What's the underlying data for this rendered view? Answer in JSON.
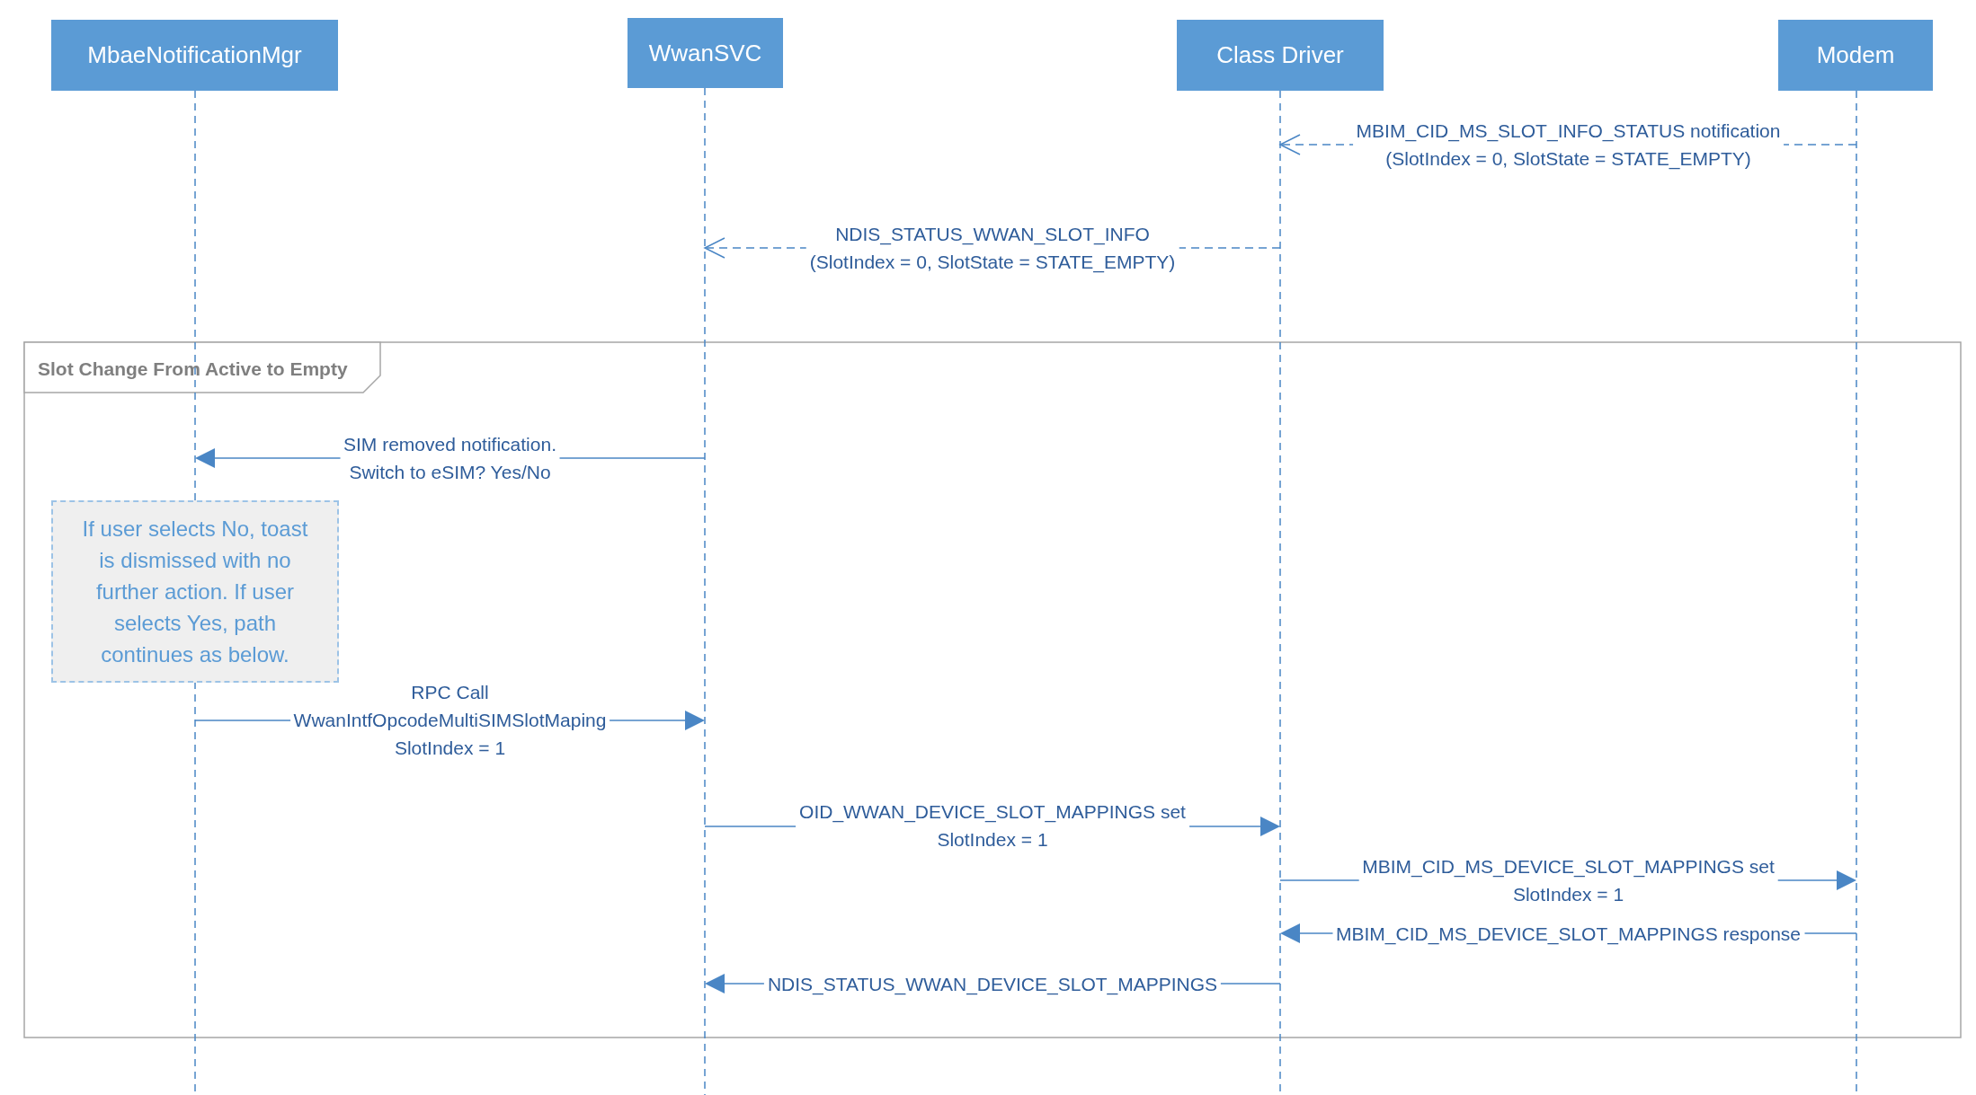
{
  "participants": [
    {
      "name": "MbaeNotificationMgr"
    },
    {
      "name": "WwanSVC"
    },
    {
      "name": "Class Driver"
    },
    {
      "name": "Modem"
    }
  ],
  "pre_messages": [
    {
      "kind": "reply",
      "lines": [
        "MBIM_CID_MS_SLOT_INFO_STATUS notification",
        "(SlotIndex = 0, SlotState = STATE_EMPTY)"
      ]
    },
    {
      "kind": "reply",
      "lines": [
        "NDIS_STATUS_WWAN_SLOT_INFO",
        "(SlotIndex = 0, SlotState = STATE_EMPTY)"
      ]
    }
  ],
  "fragment": {
    "label": "Slot Change From Active to Empty",
    "messages": [
      {
        "kind": "call",
        "lines": [
          "SIM removed notification.",
          "Switch to eSIM? Yes/No"
        ]
      },
      {
        "kind": "call",
        "lines": [
          "RPC Call",
          "WwanIntfOpcodeMultiSIMSlotMaping",
          "SlotIndex = 1"
        ]
      },
      {
        "kind": "call",
        "lines": [
          "OID_WWAN_DEVICE_SLOT_MAPPINGS set",
          "SlotIndex = 1"
        ]
      },
      {
        "kind": "call",
        "lines": [
          "MBIM_CID_MS_DEVICE_SLOT_MAPPINGS set",
          "SlotIndex = 1"
        ]
      },
      {
        "kind": "call",
        "lines": [
          "MBIM_CID_MS_DEVICE_SLOT_MAPPINGS response"
        ]
      },
      {
        "kind": "call",
        "lines": [
          "NDIS_STATUS_WWAN_DEVICE_SLOT_MAPPINGS"
        ]
      }
    ],
    "note": {
      "lines": [
        "If user selects No, toast",
        "is dismissed with no",
        "further action. If user",
        "selects Yes, path",
        "continues as below."
      ]
    }
  }
}
